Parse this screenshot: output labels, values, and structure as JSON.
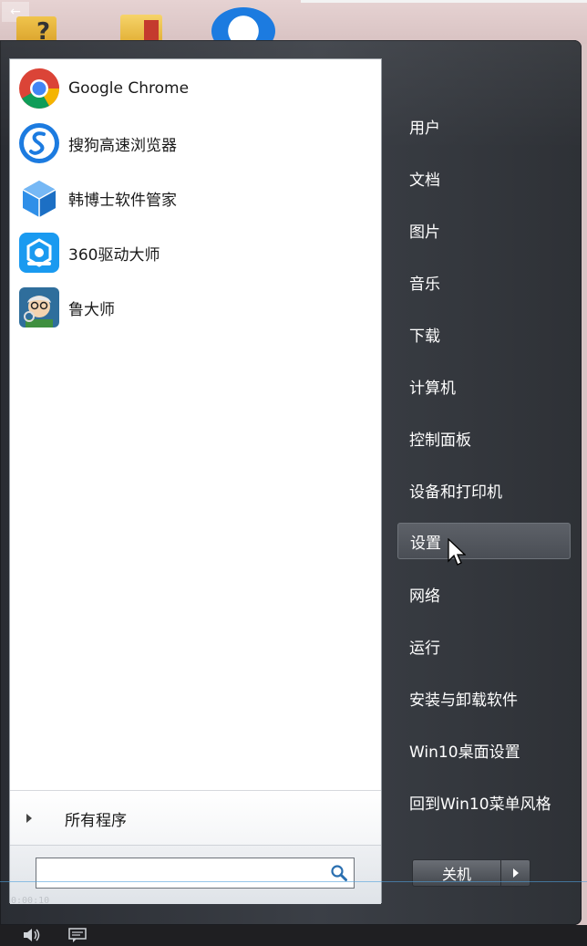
{
  "desktop": {
    "back_arrow": "←"
  },
  "pinned_apps": [
    {
      "label": "Google Chrome",
      "icon": "chrome-icon"
    },
    {
      "label": "搜狗高速浏览器",
      "icon": "sogou-browser-icon"
    },
    {
      "label": "韩博士软件管家",
      "icon": "hanboshi-icon"
    },
    {
      "label": "360驱动大师",
      "icon": "driver-master-icon"
    },
    {
      "label": "鲁大师",
      "icon": "ludashi-icon"
    }
  ],
  "all_programs": {
    "label": "所有程序"
  },
  "search": {
    "placeholder": "",
    "value": ""
  },
  "right_menu": [
    {
      "label": "用户"
    },
    {
      "label": "文档"
    },
    {
      "label": "图片"
    },
    {
      "label": "音乐"
    },
    {
      "label": "下载"
    },
    {
      "label": "计算机"
    },
    {
      "label": "控制面板"
    },
    {
      "label": "设备和打印机"
    },
    {
      "label": "设置"
    },
    {
      "label": "网络"
    },
    {
      "label": "运行"
    },
    {
      "label": "安装与卸载软件"
    },
    {
      "label": "Win10桌面设置"
    },
    {
      "label": "回到Win10菜单风格"
    }
  ],
  "hovered_item": "设置",
  "shutdown": {
    "label": "关机"
  },
  "overlay": {
    "timestamp": "0:00:10"
  },
  "colors": {
    "menu_bg": "#33363c",
    "left_pane_bg": "#ffffff",
    "accent_blue": "#1c7be0"
  }
}
